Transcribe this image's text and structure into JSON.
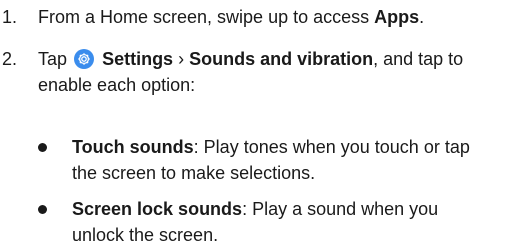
{
  "steps": [
    {
      "number": "1.",
      "text_before": "From a Home screen, swipe up to access ",
      "bold": "Apps",
      "text_after": "."
    },
    {
      "number": "2.",
      "tap": "Tap",
      "icon": "settings-gear-icon",
      "settings": "Settings",
      "arrow": "›",
      "sounds": "Sounds and vibration",
      "text_after_line1": ", and tap to",
      "line2": "enable each option:"
    }
  ],
  "options": [
    {
      "label": "Touch sounds",
      "desc_line1": ": Play tones when you touch or tap",
      "desc_line2": "the screen to make selections."
    },
    {
      "label": "Screen lock sounds",
      "desc_line1": ": Play a sound when you",
      "desc_line2": "unlock the screen."
    }
  ],
  "colors": {
    "icon_background": "#3b8ded",
    "text": "#1a1a1a"
  }
}
